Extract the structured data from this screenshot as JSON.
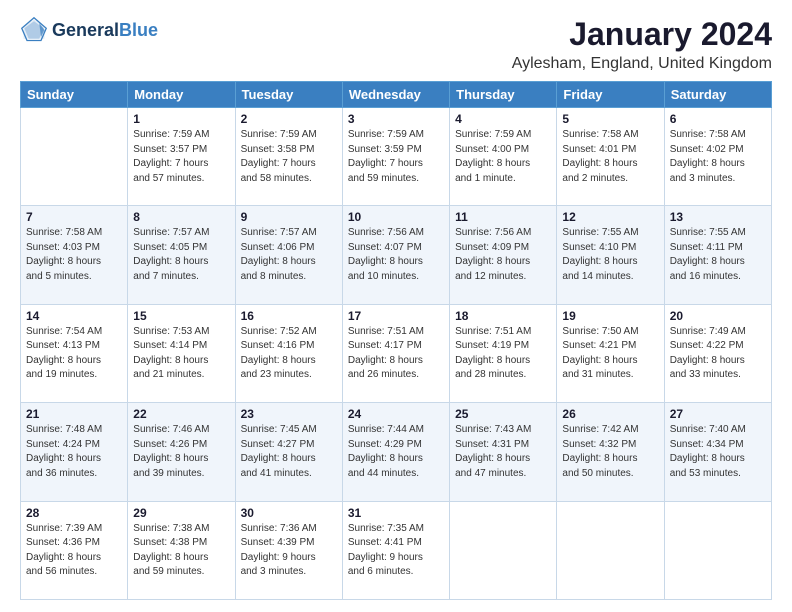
{
  "logo": {
    "line1": "General",
    "line2": "Blue"
  },
  "header": {
    "title": "January 2024",
    "subtitle": "Aylesham, England, United Kingdom"
  },
  "weekdays": [
    "Sunday",
    "Monday",
    "Tuesday",
    "Wednesday",
    "Thursday",
    "Friday",
    "Saturday"
  ],
  "weeks": [
    [
      {
        "day": "",
        "info": ""
      },
      {
        "day": "1",
        "info": "Sunrise: 7:59 AM\nSunset: 3:57 PM\nDaylight: 7 hours\nand 57 minutes."
      },
      {
        "day": "2",
        "info": "Sunrise: 7:59 AM\nSunset: 3:58 PM\nDaylight: 7 hours\nand 58 minutes."
      },
      {
        "day": "3",
        "info": "Sunrise: 7:59 AM\nSunset: 3:59 PM\nDaylight: 7 hours\nand 59 minutes."
      },
      {
        "day": "4",
        "info": "Sunrise: 7:59 AM\nSunset: 4:00 PM\nDaylight: 8 hours\nand 1 minute."
      },
      {
        "day": "5",
        "info": "Sunrise: 7:58 AM\nSunset: 4:01 PM\nDaylight: 8 hours\nand 2 minutes."
      },
      {
        "day": "6",
        "info": "Sunrise: 7:58 AM\nSunset: 4:02 PM\nDaylight: 8 hours\nand 3 minutes."
      }
    ],
    [
      {
        "day": "7",
        "info": "Sunrise: 7:58 AM\nSunset: 4:03 PM\nDaylight: 8 hours\nand 5 minutes."
      },
      {
        "day": "8",
        "info": "Sunrise: 7:57 AM\nSunset: 4:05 PM\nDaylight: 8 hours\nand 7 minutes."
      },
      {
        "day": "9",
        "info": "Sunrise: 7:57 AM\nSunset: 4:06 PM\nDaylight: 8 hours\nand 8 minutes."
      },
      {
        "day": "10",
        "info": "Sunrise: 7:56 AM\nSunset: 4:07 PM\nDaylight: 8 hours\nand 10 minutes."
      },
      {
        "day": "11",
        "info": "Sunrise: 7:56 AM\nSunset: 4:09 PM\nDaylight: 8 hours\nand 12 minutes."
      },
      {
        "day": "12",
        "info": "Sunrise: 7:55 AM\nSunset: 4:10 PM\nDaylight: 8 hours\nand 14 minutes."
      },
      {
        "day": "13",
        "info": "Sunrise: 7:55 AM\nSunset: 4:11 PM\nDaylight: 8 hours\nand 16 minutes."
      }
    ],
    [
      {
        "day": "14",
        "info": "Sunrise: 7:54 AM\nSunset: 4:13 PM\nDaylight: 8 hours\nand 19 minutes."
      },
      {
        "day": "15",
        "info": "Sunrise: 7:53 AM\nSunset: 4:14 PM\nDaylight: 8 hours\nand 21 minutes."
      },
      {
        "day": "16",
        "info": "Sunrise: 7:52 AM\nSunset: 4:16 PM\nDaylight: 8 hours\nand 23 minutes."
      },
      {
        "day": "17",
        "info": "Sunrise: 7:51 AM\nSunset: 4:17 PM\nDaylight: 8 hours\nand 26 minutes."
      },
      {
        "day": "18",
        "info": "Sunrise: 7:51 AM\nSunset: 4:19 PM\nDaylight: 8 hours\nand 28 minutes."
      },
      {
        "day": "19",
        "info": "Sunrise: 7:50 AM\nSunset: 4:21 PM\nDaylight: 8 hours\nand 31 minutes."
      },
      {
        "day": "20",
        "info": "Sunrise: 7:49 AM\nSunset: 4:22 PM\nDaylight: 8 hours\nand 33 minutes."
      }
    ],
    [
      {
        "day": "21",
        "info": "Sunrise: 7:48 AM\nSunset: 4:24 PM\nDaylight: 8 hours\nand 36 minutes."
      },
      {
        "day": "22",
        "info": "Sunrise: 7:46 AM\nSunset: 4:26 PM\nDaylight: 8 hours\nand 39 minutes."
      },
      {
        "day": "23",
        "info": "Sunrise: 7:45 AM\nSunset: 4:27 PM\nDaylight: 8 hours\nand 41 minutes."
      },
      {
        "day": "24",
        "info": "Sunrise: 7:44 AM\nSunset: 4:29 PM\nDaylight: 8 hours\nand 44 minutes."
      },
      {
        "day": "25",
        "info": "Sunrise: 7:43 AM\nSunset: 4:31 PM\nDaylight: 8 hours\nand 47 minutes."
      },
      {
        "day": "26",
        "info": "Sunrise: 7:42 AM\nSunset: 4:32 PM\nDaylight: 8 hours\nand 50 minutes."
      },
      {
        "day": "27",
        "info": "Sunrise: 7:40 AM\nSunset: 4:34 PM\nDaylight: 8 hours\nand 53 minutes."
      }
    ],
    [
      {
        "day": "28",
        "info": "Sunrise: 7:39 AM\nSunset: 4:36 PM\nDaylight: 8 hours\nand 56 minutes."
      },
      {
        "day": "29",
        "info": "Sunrise: 7:38 AM\nSunset: 4:38 PM\nDaylight: 8 hours\nand 59 minutes."
      },
      {
        "day": "30",
        "info": "Sunrise: 7:36 AM\nSunset: 4:39 PM\nDaylight: 9 hours\nand 3 minutes."
      },
      {
        "day": "31",
        "info": "Sunrise: 7:35 AM\nSunset: 4:41 PM\nDaylight: 9 hours\nand 6 minutes."
      },
      {
        "day": "",
        "info": ""
      },
      {
        "day": "",
        "info": ""
      },
      {
        "day": "",
        "info": ""
      }
    ]
  ]
}
